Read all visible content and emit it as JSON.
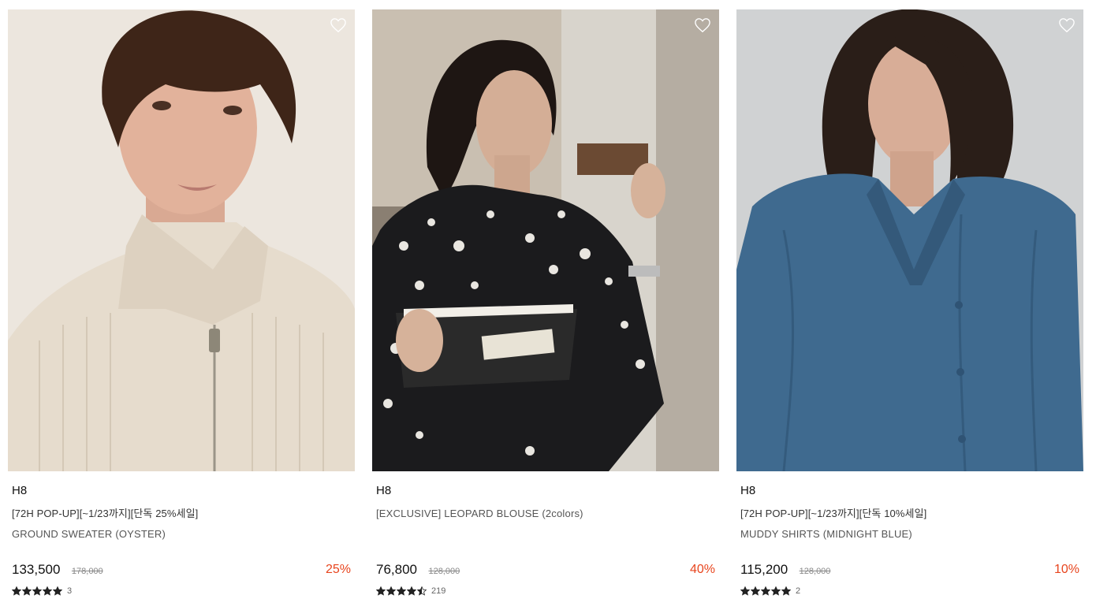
{
  "products": [
    {
      "brand": "H8",
      "promo": "[72H POP-UP][~1/23까지][단독 25%세일]",
      "name": "GROUND SWEATER (OYSTER)",
      "price": "133,500",
      "original_price": "178,000",
      "discount": "25%",
      "rating": 5,
      "review_count": "3",
      "image": "woman-in-cream-zip-knit-sweater"
    },
    {
      "brand": "H8",
      "promo": "",
      "name": "[EXCLUSIVE] LEOPARD BLOUSE (2colors)",
      "price": "76,800",
      "original_price": "128,000",
      "discount": "40%",
      "rating": 4.5,
      "review_count": "219",
      "image": "woman-in-black-spotted-blouse-reading"
    },
    {
      "brand": "H8",
      "promo": "[72H POP-UP][~1/23까지][단독 10%세일]",
      "name": "MUDDY SHIRTS (MIDNIGHT BLUE)",
      "price": "115,200",
      "original_price": "128,000",
      "discount": "10%",
      "rating": 5,
      "review_count": "2",
      "image": "woman-in-blue-silk-shirt"
    }
  ],
  "icons": {
    "wishlist": "heart-outline-icon",
    "rating": "star-icon"
  },
  "colors": {
    "discount": "#e8451e",
    "star": "#222222"
  }
}
